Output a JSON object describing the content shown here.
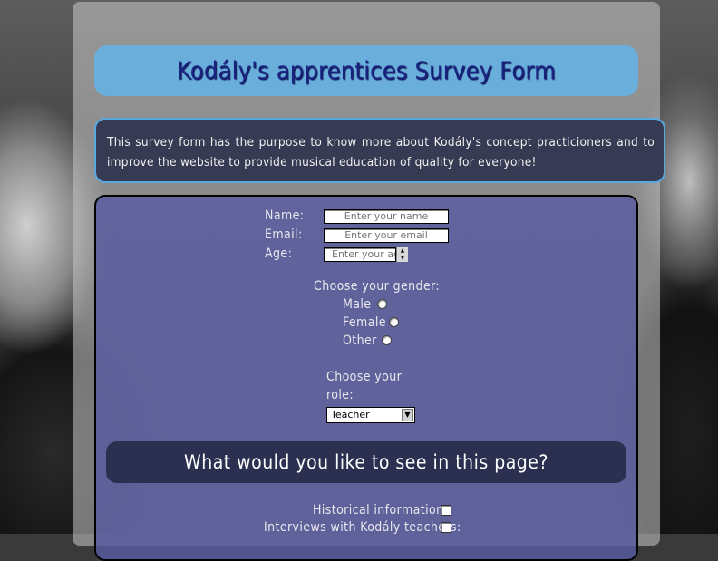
{
  "header": {
    "title": "Kodály's apprentices Survey Form"
  },
  "description": "This survey form has the purpose to know more about Kodály's concept practicioners and to improve the website to provide musical education of quality for everyone!",
  "form": {
    "name_label": "Name:",
    "name_placeholder": "Enter your name",
    "email_label": "Email:",
    "email_placeholder": "Enter your email",
    "age_label": "Age:",
    "age_placeholder": "Enter your age",
    "gender_heading": "Choose your gender:",
    "gender_options": [
      "Male",
      "Female",
      "Other"
    ],
    "role_heading_line1": "Choose your",
    "role_heading_line2": "role:",
    "role_selected": "Teacher",
    "question": "What would you like to see in this page?",
    "checkbox_options": [
      "Historical information:",
      "Interviews with Kodály teachers:"
    ]
  }
}
